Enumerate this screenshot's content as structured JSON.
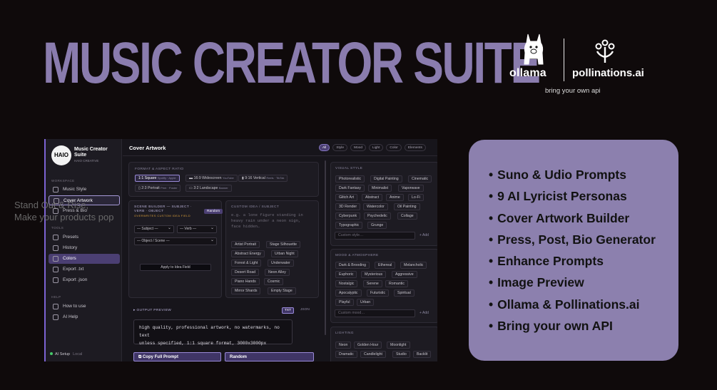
{
  "hero": {
    "title": "MUSIC CREATOR SUITE"
  },
  "brand": {
    "ollama": "ollama",
    "pollinations": "pollinations.ai",
    "tagline": "bring your own api"
  },
  "features": [
    "Suno & Udio Prompts",
    "9 AI Lyricist Personas",
    "Cover Artwork Builder",
    "Press, Post, Bio Generator",
    "Enhance Prompts",
    "Image Preview",
    "Ollama & Pollinations.ai",
    "Bring your own API"
  ],
  "overlay": {
    "line1": "Stand Out & Rise,",
    "line2": "Make your products pop"
  },
  "app": {
    "logo_text": "HAIO",
    "title": "Music Creator Suite",
    "subtitle": "HAIO CREATIVE",
    "sections": {
      "workspace": "WORKSPACE",
      "tools": "TOOLS",
      "help": "HELP"
    },
    "nav": {
      "music_style": "Music Style",
      "cover_artwork": "Cover Artwork",
      "press_bio": "Press & Bio",
      "presets": "Presets",
      "history": "History",
      "colors": "Colors",
      "export_txt": "Export .txt",
      "export_json": "Export .json",
      "how_to_use": "How to use",
      "ai_help": "AI Help"
    },
    "footer": {
      "ai_setup": "AI Setup",
      "local": "Local"
    },
    "page_title": "Cover Artwork",
    "filters": [
      "All",
      "Style",
      "Mood",
      "Light",
      "Color",
      "Elements"
    ],
    "format": {
      "label": "FORMAT & ASPECT RATIO",
      "options": [
        {
          "label": "1:1 Square",
          "hint": "Spotify · Apple"
        },
        {
          "label": "16:9 Widescreen",
          "hint": "YouTube"
        },
        {
          "label": "9:16 Vertical",
          "hint": "Reels · TikTok"
        },
        {
          "label": "2:3 Portrait",
          "hint": "Print · Poster"
        },
        {
          "label": "3:2 Landscape",
          "hint": "Banner"
        }
      ]
    },
    "scene": {
      "label": "SCENE BUILDER — SUBJECT · VERB · OBJECT",
      "note": "OVERWRITES CUSTOM IDEA FIELD",
      "random": "Random",
      "subject": "— Subject —",
      "verb": "— Verb —",
      "object": "— Object / Scene —",
      "apply": "Apply to Idea Field"
    },
    "custom": {
      "label": "CUSTOM IDEA / SUBJECT",
      "placeholder_lines": [
        "e.g. a lone figure standing in",
        "heavy rain under a neon sign,",
        "face hidden…"
      ],
      "chips": [
        "Artist Portrait",
        "Stage Silhouette",
        "Abstract Energy",
        "Urban Night",
        "Forest & Light",
        "Underwater",
        "Desert Road",
        "Neon Alley",
        "Piano Hands",
        "Cosmic",
        "Mirror Shards",
        "Empty Stage"
      ]
    },
    "output": {
      "label": "OUTPUT PREVIEW",
      "tab_txt": "TXT",
      "tab_json": "JSON",
      "text_line1": "high quality, professional artwork, no watermarks, no text",
      "text_line2": "unless specified, 1:1 square format, 3000x3000px",
      "copy": "Copy Full Prompt",
      "random": "Random"
    },
    "visual_style": {
      "label": "VISUAL STYLE",
      "chips": [
        "Photorealistic",
        "Digital Painting",
        "Cinematic",
        "Dark Fantasy",
        "Minimalist",
        "Vaporwave",
        "Glitch Art",
        "Abstract",
        "Anime",
        "Lo-Fi",
        "3D Render",
        "Watercolor",
        "Oil Painting",
        "Cyberpunk",
        "Psychedelic",
        "Collage",
        "Typographic",
        "Grunge"
      ],
      "input": "Custom style…",
      "add": "+ Add"
    },
    "mood": {
      "label": "MOOD & ATMOSPHERE",
      "chips": [
        "Dark & Brooding",
        "Ethereal",
        "Melancholic",
        "Euphoric",
        "Mysterious",
        "Aggressive",
        "Nostalgic",
        "Serene",
        "Romantic",
        "Apocalyptic",
        "Futuristic",
        "Spiritual",
        "Playful",
        "Urban"
      ],
      "input": "Custom mood…",
      "add": "+ Add"
    },
    "lighting": {
      "label": "LIGHTING",
      "chips": [
        "Neon",
        "Golden Hour",
        "Moonlight",
        "Dramatic",
        "Candlelight",
        "Studio",
        "Backlit"
      ]
    }
  }
}
